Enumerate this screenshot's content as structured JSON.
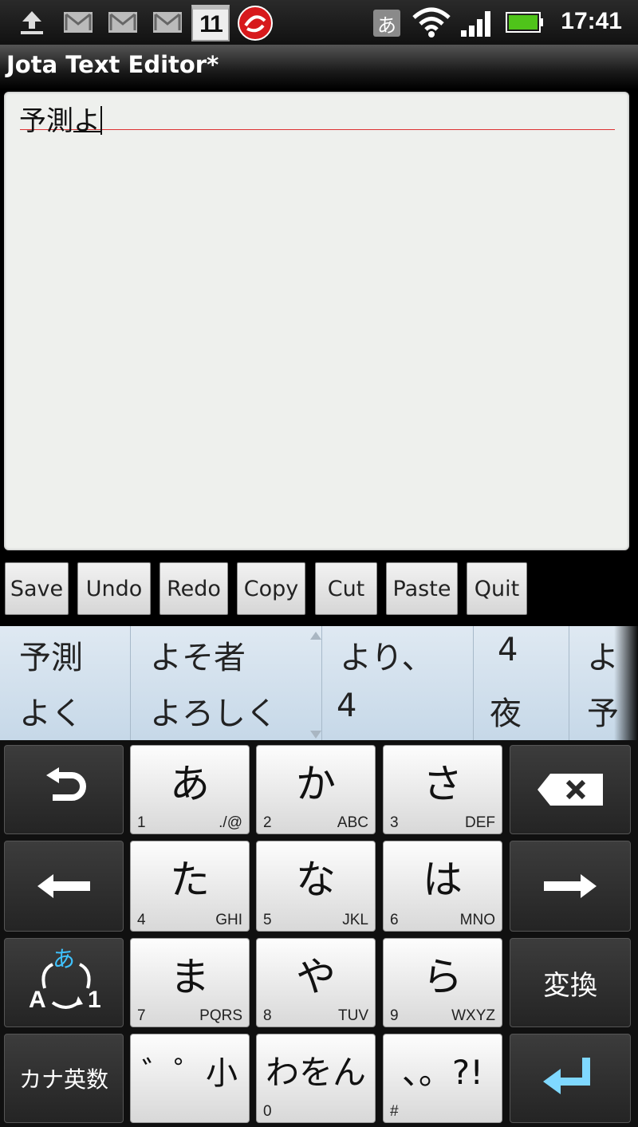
{
  "status_bar": {
    "time": "17:41",
    "ime_indicator": "あ",
    "calendar_day": "11",
    "icons": [
      "upload-icon",
      "gmail-icon",
      "gmail-icon",
      "gmail-icon",
      "calendar-icon",
      "security-icon",
      "ime-icon",
      "wifi-icon",
      "signal-icon",
      "battery-icon"
    ]
  },
  "app": {
    "title": "Jota Text Editor*"
  },
  "editor": {
    "text_committed": "予測",
    "text_composing": "よ"
  },
  "toolbar": {
    "buttons": [
      "Save",
      "Undo",
      "Redo",
      "Copy",
      "Cut",
      "Paste",
      "Quit"
    ]
  },
  "candidates": {
    "row1": [
      "予測",
      "よそ者",
      "より、",
      "4",
      "よ"
    ],
    "row2": [
      "よく",
      "よろしく",
      "4",
      "夜",
      "予"
    ]
  },
  "keyboard": {
    "keys": [
      {
        "main": "あ",
        "num": "1",
        "sub": "./@"
      },
      {
        "main": "か",
        "num": "2",
        "sub": "ABC"
      },
      {
        "main": "さ",
        "num": "3",
        "sub": "DEF"
      },
      {
        "main": "た",
        "num": "4",
        "sub": "GHI"
      },
      {
        "main": "な",
        "num": "5",
        "sub": "JKL"
      },
      {
        "main": "は",
        "num": "6",
        "sub": "MNO"
      },
      {
        "main": "ま",
        "num": "7",
        "sub": "PQRS"
      },
      {
        "main": "や",
        "num": "8",
        "sub": "TUV"
      },
      {
        "main": "ら",
        "num": "9",
        "sub": "WXYZ"
      },
      {
        "main": "゛゜小",
        "num": "*",
        "sub": ""
      },
      {
        "main": "わをん",
        "num": "0",
        "sub": ""
      },
      {
        "main": "、。?!",
        "num": "#",
        "sub": ""
      }
    ],
    "convert_label": "変換",
    "kana_eisu_label": "カナ英数",
    "mode_switch": {
      "top": "あ",
      "bottom_left": "A",
      "bottom_right": "1"
    }
  },
  "colors": {
    "accent_blue": "#3fc3ff",
    "editor_bg": "#eef0ed",
    "candidate_bg": "#d4e2ee"
  }
}
